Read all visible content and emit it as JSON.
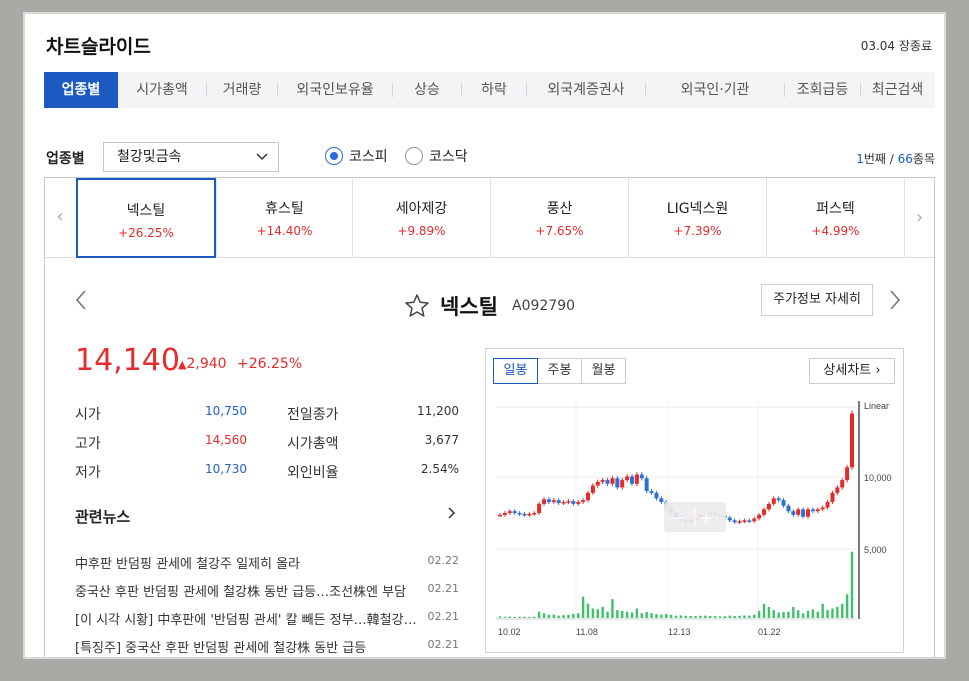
{
  "header": {
    "title": "차트슬라이드",
    "datetime": "03.04 장종료"
  },
  "tabs": [
    "업종별",
    "시가총액",
    "거래량",
    "외국인보유율",
    "상승",
    "하락",
    "외국계증권사",
    "외국인·기관",
    "조회급등",
    "최근검색"
  ],
  "filter": {
    "label": "업종별",
    "selected": "철강및금속",
    "radio": [
      {
        "label": "코스피",
        "checked": true
      },
      {
        "label": "코스닥",
        "checked": false
      }
    ],
    "current": "1",
    "current_suffix": "번째 / ",
    "total": "66",
    "total_suffix": "종목"
  },
  "stocks": [
    {
      "name": "넥스틸",
      "change": "+26.25%"
    },
    {
      "name": "휴스틸",
      "change": "+14.40%"
    },
    {
      "name": "세아제강",
      "change": "+9.89%"
    },
    {
      "name": "풍산",
      "change": "+7.65%"
    },
    {
      "name": "LIG넥스원",
      "change": "+7.39%"
    },
    {
      "name": "퍼스텍",
      "change": "+4.99%"
    }
  ],
  "detail": {
    "name": "넥스틸",
    "code": "A092790",
    "detail_button": "주가정보 자세히",
    "price": "14,140",
    "change_amount": "2,940",
    "change_percent": "+26.25%",
    "quotes_left": [
      {
        "label": "시가",
        "value": "10,750",
        "tone": "blue"
      },
      {
        "label": "고가",
        "value": "14,560",
        "tone": "red"
      },
      {
        "label": "저가",
        "value": "10,730",
        "tone": "blue"
      }
    ],
    "quotes_right": [
      {
        "label": "전일종가",
        "value": "11,200"
      },
      {
        "label": "시가총액",
        "value": "3,677"
      },
      {
        "label": "외인비율",
        "value": "2.54%"
      }
    ]
  },
  "news": {
    "title": "관련뉴스",
    "items": [
      {
        "text": "中후판 반덤핑 관세에 철강주 일제히 올라",
        "date": "02.22"
      },
      {
        "text": "중국산 후판 반덤핑 관세에 철강株 동반 급등…조선株엔 부담",
        "date": "02.21"
      },
      {
        "text": "[이 시각 시황] 中후판에 '반덤핑 관세' 칼 빼든 정부…韓철강 반등",
        "date": "02.21"
      },
      {
        "text": "[특징주] 중국산 후판 반덤핑 관세에 철강株 동반 급등",
        "date": "02.21"
      }
    ]
  },
  "chart": {
    "tabs": [
      "일봉",
      "주봉",
      "월봉"
    ],
    "detail_button": "상세차트",
    "scale": "Linear",
    "price_label": "10,000",
    "volume_label": "5,000",
    "x_labels": [
      "10.02",
      "11.08",
      "12.13",
      "01.22"
    ],
    "zoom_out": "−",
    "zoom_in": "+"
  },
  "chart_data": {
    "type": "candlestick",
    "x_labels": [
      "10.02",
      "11.08",
      "12.13",
      "01.22"
    ],
    "price_reference": 10000,
    "volume_reference": 5000,
    "closes": [
      8600,
      8700,
      8800,
      8700,
      8650,
      8600,
      8650,
      8700,
      9200,
      9450,
      9300,
      9400,
      9250,
      9300,
      9350,
      9200,
      9300,
      9400,
      9800,
      10200,
      10400,
      10500,
      10300,
      10600,
      10100,
      10500,
      10700,
      10300,
      10800,
      10600,
      9900,
      9800,
      9500,
      9300,
      9000,
      8700,
      8400,
      8300,
      8200,
      8300,
      8450,
      8600,
      8650,
      8700,
      8600,
      8550,
      8450,
      8300,
      8200,
      8250,
      8300,
      8250,
      8400,
      8600,
      8900,
      9200,
      9500,
      9400,
      9100,
      8800,
      8600,
      8900,
      8500,
      8900,
      8800,
      8900,
      9000,
      9300,
      9800,
      10100,
      10500,
      11200,
      14140
    ],
    "volumes": [
      100,
      80,
      90,
      70,
      80,
      70,
      60,
      80,
      400,
      300,
      200,
      220,
      150,
      180,
      200,
      260,
      300,
      1350,
      900,
      600,
      550,
      700,
      400,
      1200,
      500,
      450,
      400,
      350,
      600,
      300,
      380,
      300,
      250,
      220,
      250,
      200,
      150,
      160,
      140,
      130,
      120,
      140,
      150,
      130,
      120,
      100,
      110,
      150,
      130,
      140,
      160,
      150,
      200,
      450,
      900,
      700,
      500,
      350,
      380,
      400,
      700,
      500,
      300,
      450,
      550,
      400,
      900,
      500,
      600,
      700,
      900,
      1500,
      4200
    ]
  }
}
